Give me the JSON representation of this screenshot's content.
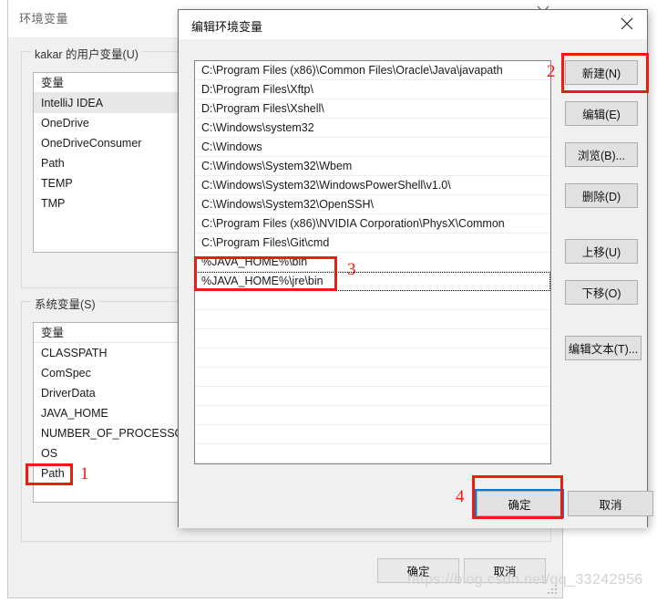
{
  "background_window": {
    "title": "环境变量",
    "user_vars_group": {
      "legend": "kakar 的用户变量(U)",
      "column_header": "变量",
      "rows": [
        {
          "name": "IntelliJ IDEA",
          "selected": true
        },
        {
          "name": "OneDrive",
          "selected": false
        },
        {
          "name": "OneDriveConsumer",
          "selected": false
        },
        {
          "name": "Path",
          "selected": false
        },
        {
          "name": "TEMP",
          "selected": false
        },
        {
          "name": "TMP",
          "selected": false
        }
      ]
    },
    "system_vars_group": {
      "legend": "系统变量(S)",
      "column_header": "变量",
      "rows": [
        {
          "name": "CLASSPATH",
          "selected": false
        },
        {
          "name": "ComSpec",
          "selected": false
        },
        {
          "name": "DriverData",
          "selected": false
        },
        {
          "name": "JAVA_HOME",
          "selected": false
        },
        {
          "name": "NUMBER_OF_PROCESSORS",
          "selected": false
        },
        {
          "name": "OS",
          "selected": false
        },
        {
          "name": "Path",
          "selected": false,
          "highlighted": true
        }
      ]
    },
    "buttons": {
      "ok": "确定",
      "cancel": "取消"
    }
  },
  "dialog": {
    "title": "编辑环境变量",
    "close_label": "✕",
    "path_entries": [
      "C:\\Program Files (x86)\\Common Files\\Oracle\\Java\\javapath",
      "D:\\Program Files\\Xftp\\",
      "D:\\Program Files\\Xshell\\",
      "C:\\Windows\\system32",
      "C:\\Windows",
      "C:\\Windows\\System32\\Wbem",
      "C:\\Windows\\System32\\WindowsPowerShell\\v1.0\\",
      "C:\\Windows\\System32\\OpenSSH\\",
      "C:\\Program Files (x86)\\NVIDIA Corporation\\PhysX\\Common",
      "C:\\Program Files\\Git\\cmd",
      "%JAVA_HOME%\\bin",
      "%JAVA_HOME%\\jre\\bin"
    ],
    "empty_row_count": 9,
    "focused_entry_index": 11,
    "side_buttons": [
      {
        "label": "新建(N)",
        "name": "new-button"
      },
      {
        "label": "编辑(E)",
        "name": "edit-button"
      },
      {
        "label": "浏览(B)...",
        "name": "browse-button"
      },
      {
        "label": "删除(D)",
        "name": "delete-button"
      },
      {
        "label": "上移(U)",
        "name": "move-up-button"
      },
      {
        "label": "下移(O)",
        "name": "move-down-button"
      },
      {
        "label": "编辑文本(T)...",
        "name": "edit-text-button"
      }
    ],
    "buttons": {
      "ok": "确定",
      "cancel": "取消"
    }
  },
  "annotations": {
    "step1": "1",
    "step2": "2",
    "step3": "3",
    "step4": "4",
    "color": "#ee1b10"
  },
  "watermark": "https://blog.csdn.net/qq_33242956"
}
